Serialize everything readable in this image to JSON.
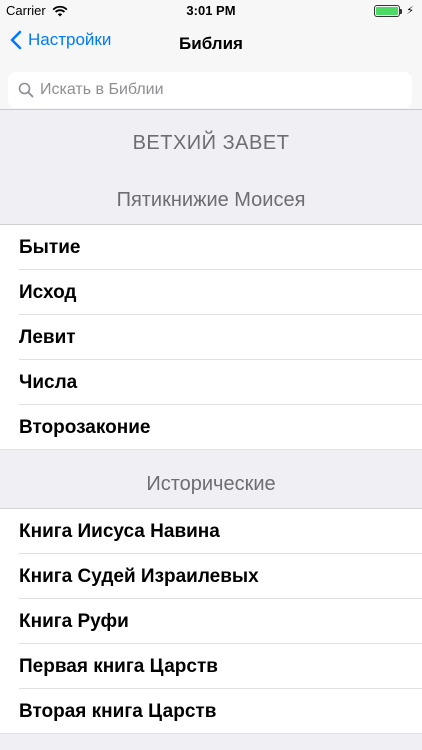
{
  "status_bar": {
    "carrier": "Carrier",
    "time": "3:01 PM"
  },
  "nav": {
    "back_label": "Настройки",
    "title": "Библия"
  },
  "search": {
    "placeholder": "Искать в Библии",
    "value": ""
  },
  "testament": {
    "title": "ВЕТХИЙ ЗАВЕТ"
  },
  "sections": [
    {
      "title": "Пятикнижие Моисея",
      "items": [
        "Бытие",
        "Исход",
        "Левит",
        "Числа",
        "Второзаконие"
      ]
    },
    {
      "title": "Исторические",
      "items": [
        "Книга Иисуса Навина",
        "Книга Судей Израилевых",
        "Книга Руфи",
        "Первая книга Царств",
        "Вторая книга Царств"
      ]
    }
  ],
  "colors": {
    "accent": "#007aff",
    "battery": "#4cd964",
    "header_text": "#6d6d72"
  }
}
